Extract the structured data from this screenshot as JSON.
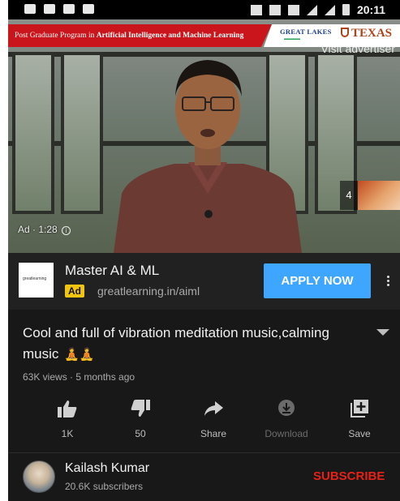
{
  "status_bar": {
    "time": "20:11"
  },
  "video": {
    "banner_prefix": "Post Graduate Program in ",
    "banner_bold": "Artificial Intelligence and Machine Learning",
    "brand_left": "GREAT LAKES",
    "brand_right": "TEXAS",
    "visit_advertiser": "Visit advertiser",
    "ad_timer": "Ad · 1:28",
    "info_icon": "i",
    "skip_thumbnail_count": "4"
  },
  "ad": {
    "title": "Master AI & ML",
    "badge": "Ad",
    "url": "greatlearning.in/aiml",
    "cta": "APPLY NOW",
    "logo_text": "greatlearning"
  },
  "video_info": {
    "title": "Cool and full of vibration meditation music,calming music",
    "title_emoji": "🧘🧘",
    "meta": "63K views · 5 months ago"
  },
  "actions": [
    {
      "label": "1K",
      "icon": "thumbs-up-icon",
      "enabled": true
    },
    {
      "label": "50",
      "icon": "thumbs-down-icon",
      "enabled": true
    },
    {
      "label": "Share",
      "icon": "share-icon",
      "enabled": true
    },
    {
      "label": "Download",
      "icon": "download-icon",
      "enabled": false
    },
    {
      "label": "Save",
      "icon": "save-to-playlist-icon",
      "enabled": true
    }
  ],
  "channel": {
    "name": "Kailash Kumar",
    "subscribers": "20.6K subscribers",
    "subscribe_label": "SUBSCRIBE"
  },
  "colors": {
    "accent_blue": "#3ea6ff",
    "subscribe_red": "#e62117",
    "ad_badge_yellow": "#f1c40f",
    "banner_red": "#c9151b"
  }
}
